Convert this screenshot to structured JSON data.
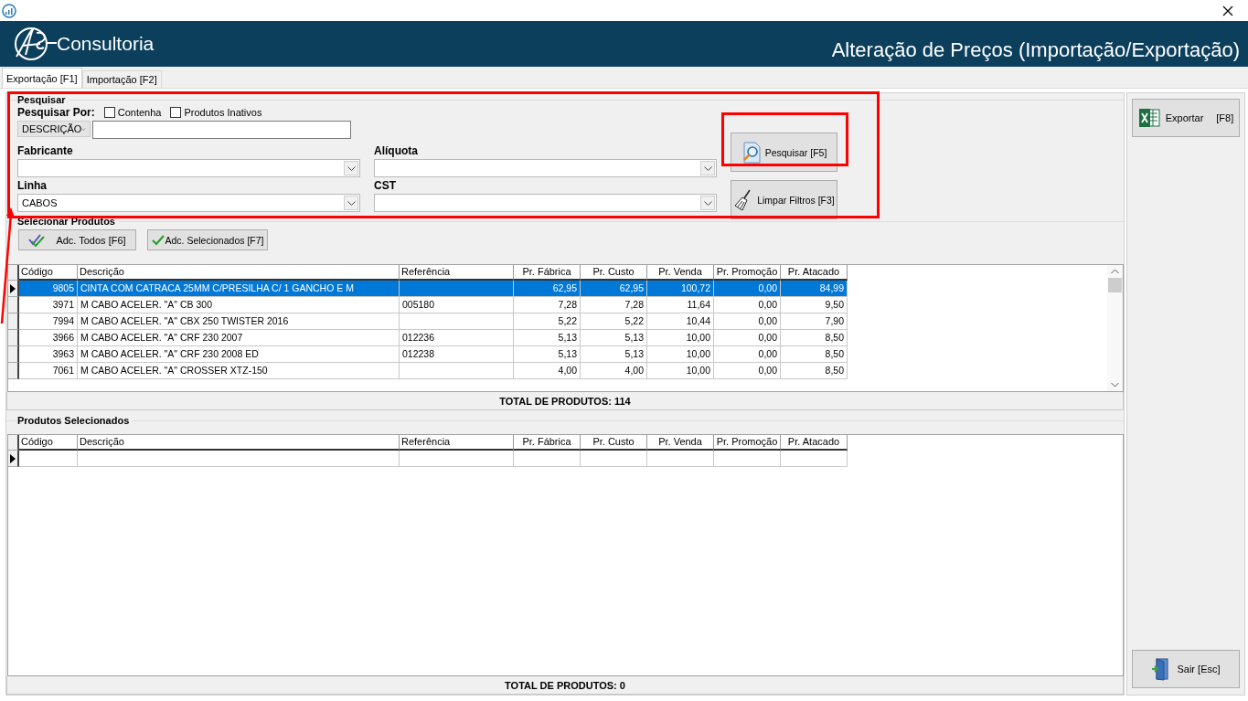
{
  "header": {
    "logo_text": "Consultoria",
    "title": "Alteração de Preços (Importação/Exportação)"
  },
  "tabs": [
    {
      "label": "Exportação [F1]",
      "selected": true
    },
    {
      "label": "Importação [F2]",
      "selected": false
    }
  ],
  "search_group": {
    "title": "Pesquisar",
    "search_by_label": "Pesquisar Por:",
    "options": [
      {
        "label": "Contenha",
        "checked": false
      },
      {
        "label": "Produtos Inativos",
        "checked": false
      }
    ],
    "search_by_value": "DESCRIÇÃO",
    "fields": [
      {
        "label": "Fabricante"
      },
      {
        "label": "Alíquota"
      },
      {
        "label": "Linha",
        "value": "CABOS"
      },
      {
        "label": "CST"
      }
    ],
    "search_button": "Pesquisar [F5]",
    "clear_button": "Limpar Filtros [F3]"
  },
  "select_group": {
    "title": "Selecionar Produtos",
    "add_all_button": "Adc. Todos [F6]",
    "add_selected_button": "Adc. Selecionados [F7]"
  },
  "columns": [
    "Código",
    "Descrição",
    "Referência",
    "Pr. Fábrica",
    "Pr. Custo",
    "Pr. Venda",
    "Pr. Promoção",
    "Pr. Atacado"
  ],
  "rows": [
    {
      "selected": true,
      "cells": [
        "9805",
        "CINTA COM CATRACA 25MM C/PRESILHA C/ 1 GANCHO E M",
        "",
        "62,95",
        "62,95",
        "100,72",
        "0,00",
        "84,99"
      ]
    },
    {
      "selected": false,
      "cells": [
        "3971",
        "M CABO ACELER. \"A\" CB 300",
        "005180",
        "7,28",
        "7,28",
        "11,64",
        "0,00",
        "9,50"
      ]
    },
    {
      "selected": false,
      "cells": [
        "7994",
        "M CABO ACELER. \"A\" CBX 250 TWISTER 2016",
        "",
        "5,22",
        "5,22",
        "10,44",
        "0,00",
        "7,90"
      ]
    },
    {
      "selected": false,
      "cells": [
        "3966",
        "M CABO ACELER. \"A\" CRF 230 2007",
        "012236",
        "5,13",
        "5,13",
        "10,00",
        "0,00",
        "8,50"
      ]
    },
    {
      "selected": false,
      "cells": [
        "3963",
        "M CABO ACELER. \"A\" CRF 230 2008 ED",
        "012238",
        "5,13",
        "5,13",
        "10,00",
        "0,00",
        "8,50"
      ]
    },
    {
      "selected": false,
      "cells": [
        "7061",
        "M CABO ACELER. \"A\" CROSSER XTZ-150",
        "",
        "4,00",
        "4,00",
        "10,00",
        "0,00",
        "8,50"
      ]
    }
  ],
  "total_top": "TOTAL DE PRODUTOS: 114",
  "selected_group": {
    "title": "Produtos Selecionados"
  },
  "selected_columns": [
    "Código",
    "Descrição",
    "Referência",
    "Pr. Fábrica",
    "Pr. Custo",
    "Pr. Venda",
    "Pr. Promoção",
    "Pr. Atacado"
  ],
  "total_bottom": "TOTAL DE PRODUTOS: 0",
  "side_buttons": {
    "export": "Exportar",
    "export_key": "[F8]",
    "exit": "Sair [Esc]"
  }
}
